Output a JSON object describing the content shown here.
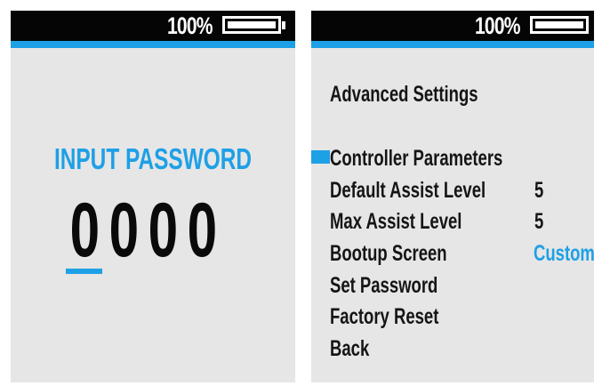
{
  "colors": {
    "accent": "#1ea0e6",
    "status_bar": "#050505",
    "screen_bg": "#e6e6e6",
    "text": "#151515"
  },
  "left_screen": {
    "battery": {
      "text": "100%",
      "level_fraction": 1.0,
      "icon": "battery-icon"
    },
    "title": "INPUT PASSWORD",
    "digits": [
      "0",
      "0",
      "0",
      "0"
    ],
    "cursor_index": 0
  },
  "right_screen": {
    "battery": {
      "text": "100%",
      "level_fraction": 1.0,
      "icon": "battery-icon"
    },
    "heading": "Advanced Settings",
    "menu": [
      {
        "label": "Controller Parameters",
        "value": "",
        "selected": true
      },
      {
        "label": "Default Assist Level",
        "value": "5",
        "selected": false
      },
      {
        "label": "Max Assist Level",
        "value": "5",
        "selected": false
      },
      {
        "label": "Bootup Screen",
        "value": "Custom",
        "selected": false,
        "value_color": "#1ea0e6"
      },
      {
        "label": "Set Password",
        "value": "",
        "selected": false
      },
      {
        "label": "Factory Reset",
        "value": "",
        "selected": false
      },
      {
        "label": "Back",
        "value": "",
        "selected": false
      }
    ]
  }
}
